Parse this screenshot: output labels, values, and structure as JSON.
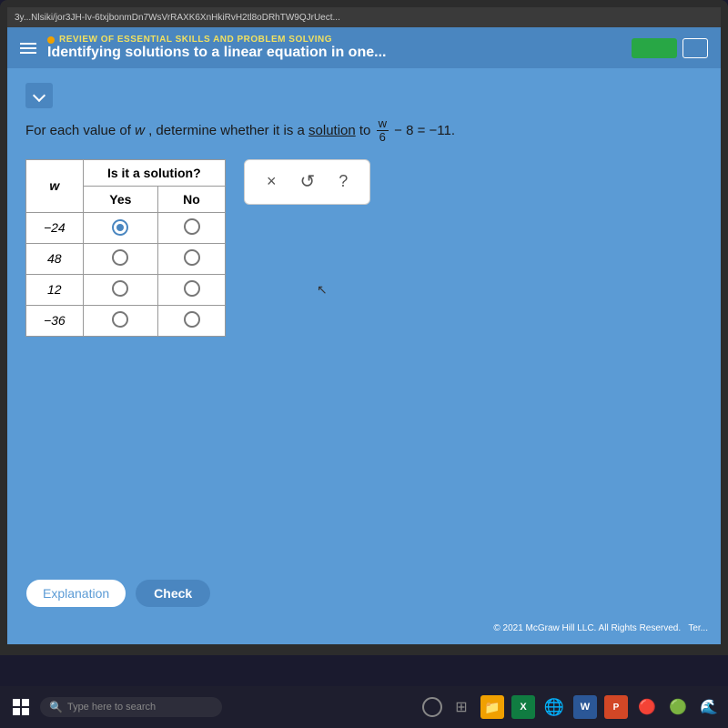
{
  "url_bar": {
    "text": "3y...Nlsiki/jor3JH-Iv-6txjbonmDn7WsVrRAXK6XnHkiRvH2tl8oDRhTW9QJrUect..."
  },
  "header": {
    "subtitle": "REVIEW OF ESSENTIAL SKILLS AND PROBLEM SOLVING",
    "title": "Identifying solutions to a linear equation in one...",
    "btn_green": "",
    "btn_outline": ""
  },
  "problem": {
    "prefix": "For each value of",
    "var": "w",
    "middle": ", determine whether it is a",
    "solution_word": "solution",
    "suffix_pre": "to",
    "equation_numerator": "w",
    "equation_denominator": "6",
    "equation_suffix": "− 8 = −11."
  },
  "table": {
    "col_w": "w",
    "header_is_solution": "Is it a solution?",
    "col_yes": "Yes",
    "col_no": "No",
    "rows": [
      {
        "value": "−24",
        "yes_selected": true,
        "no_selected": false
      },
      {
        "value": "48",
        "yes_selected": false,
        "no_selected": false
      },
      {
        "value": "12",
        "yes_selected": false,
        "no_selected": false
      },
      {
        "value": "−36",
        "yes_selected": false,
        "no_selected": false
      }
    ]
  },
  "answer_panel": {
    "x_symbol": "×",
    "undo_symbol": "↺",
    "help_symbol": "?"
  },
  "buttons": {
    "explanation": "Explanation",
    "check": "Check"
  },
  "footer": {
    "copyright": "© 2021 McGraw Hill LLC. All Rights Reserved.",
    "terms": "Ter..."
  },
  "taskbar": {
    "search_placeholder": "Type here to search"
  }
}
